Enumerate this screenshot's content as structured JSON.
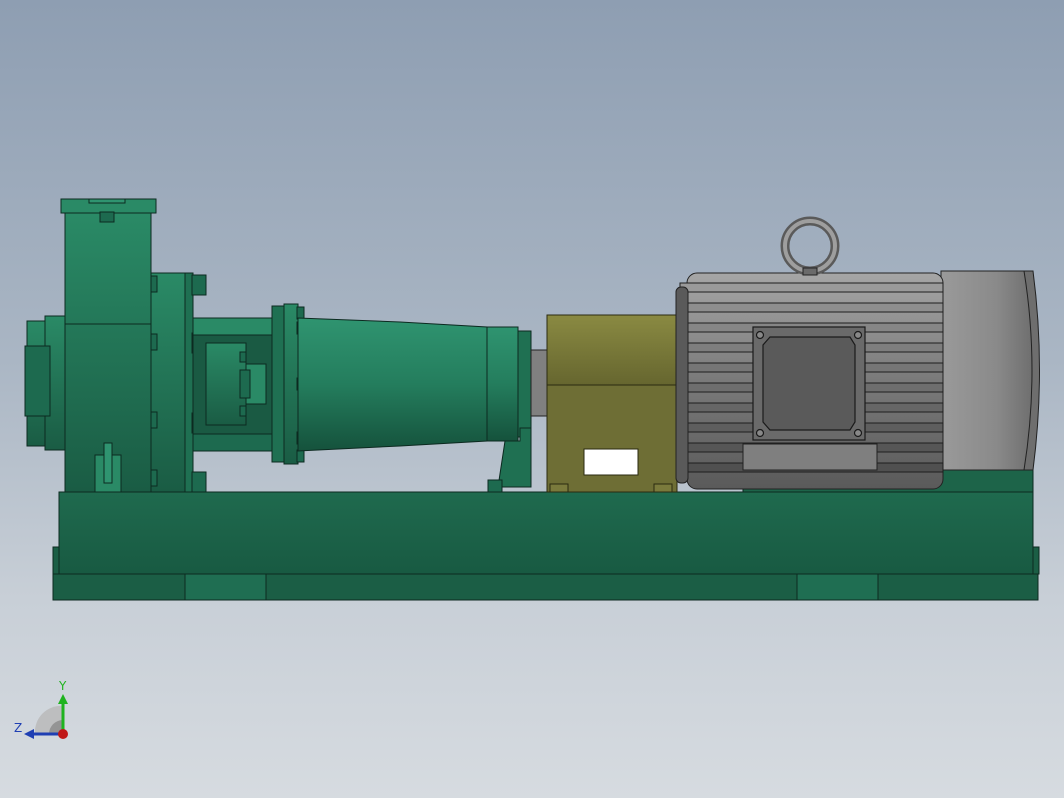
{
  "viewport": {
    "background_top": "#8e9eb2",
    "background_bottom": "#d6dbe0"
  },
  "model": {
    "parts": [
      "pump-casing",
      "bearing-frame",
      "pump-shaft-housing",
      "coupling-guard",
      "electric-motor",
      "lifting-eye",
      "terminal-box",
      "base-frame"
    ],
    "colors": {
      "pump_green": "#1e6b50",
      "pump_green_light": "#2a8a66",
      "base_green": "#1b5e45",
      "coupling_guard": "#7a7a3c",
      "motor_grey": "#8c8c8c",
      "motor_dark": "#4a4a4a",
      "edge": "#0c2a20"
    }
  },
  "triad": {
    "y_label": "Y",
    "z_label": "Z",
    "y_color": "#1fb31f",
    "z_color": "#1f3fb3",
    "x_color": "#c01818"
  }
}
